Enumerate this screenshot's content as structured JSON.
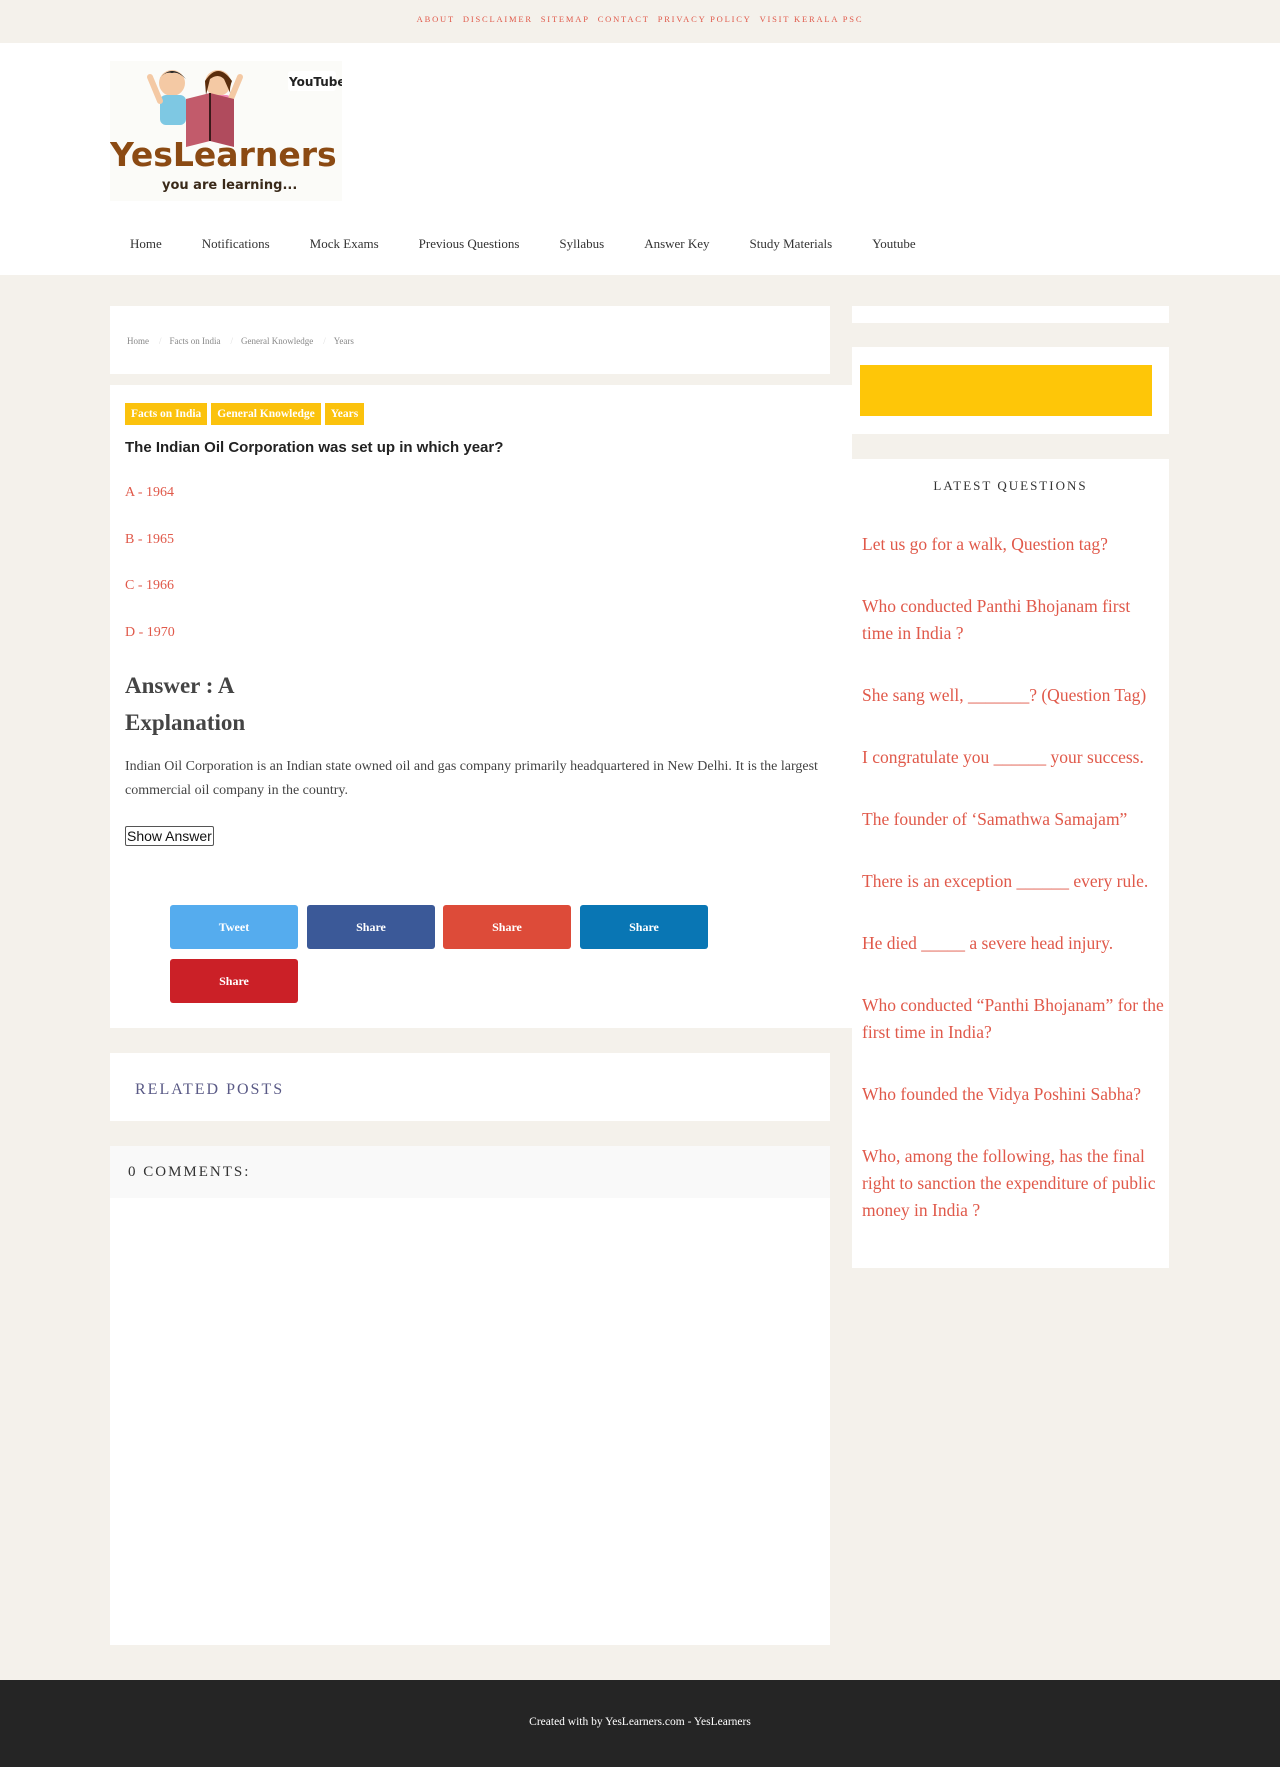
{
  "topbar": {
    "links": [
      "About",
      "Disclaimer",
      "Sitemap",
      "Contact",
      "Privacy Policy",
      "Visit Kerala PSC"
    ]
  },
  "logo": {
    "brand_text": "YesLearners",
    "tagline": "you are learning...",
    "youtube_text": "YouTube"
  },
  "nav": {
    "items": [
      "Home",
      "Notifications",
      "Mock Exams",
      "Previous Questions",
      "Syllabus",
      "Answer Key",
      "Study Materials",
      "Youtube"
    ]
  },
  "breadcrumb": {
    "items": [
      "Home",
      "Facts on India",
      "General Knowledge",
      "Years"
    ]
  },
  "post": {
    "labels": [
      "Facts on India",
      "General Knowledge",
      "Years"
    ],
    "question": "The Indian Oil Corporation was set up in which year?",
    "options": [
      "A - 1964",
      "B - 1965",
      "C - 1966",
      "D - 1970"
    ],
    "answer": "Answer : A",
    "explanation_heading": "Explanation",
    "explanation": "Indian Oil Corporation is an Indian state owned oil and gas company primarily headquartered in New Delhi. It is the largest commercial oil company in the country.",
    "show_answer_label": "Show Answer"
  },
  "share": {
    "buttons": [
      {
        "label": "Tweet",
        "icon": "twitter-icon",
        "color": "#55acee"
      },
      {
        "label": "Share",
        "icon": "facebook-icon",
        "color": "#3b5998"
      },
      {
        "label": "Share",
        "icon": "google-plus-icon",
        "color": "#dd4b39"
      },
      {
        "label": "Share",
        "icon": "linkedin-icon",
        "color": "#0976b4"
      },
      {
        "label": "Share",
        "icon": "pinterest-icon",
        "color": "#cb2027"
      }
    ]
  },
  "related": {
    "title": "Related Posts"
  },
  "comments": {
    "title": "0 comments:"
  },
  "sidebar": {
    "latest_title": "Latest Questions",
    "latest": [
      "Let us go for a walk, Question tag?",
      "Who conducted Panthi Bhojanam first time in India ?",
      "She sang well, _______? (Question Tag)",
      "I congratulate you ______ your success.",
      "The founder of ‘Samathwa Samajam”",
      "There is an exception ______ every rule.",
      "He died _____ a severe head injury.",
      "Who conducted “Panthi Bhojanam” for the first time in India?",
      "Who founded the Vidya Poshini Sabha?",
      "Who, among the following, has the final right to sanction the expenditure of public money in India ?"
    ]
  },
  "footer": {
    "text": "Created with by YesLearners.com - YesLearners"
  },
  "colors": {
    "accent": "#e0594a",
    "label_bg": "#fbc20d",
    "page_bg": "#f4f1eb",
    "footer_bg": "#252525"
  }
}
